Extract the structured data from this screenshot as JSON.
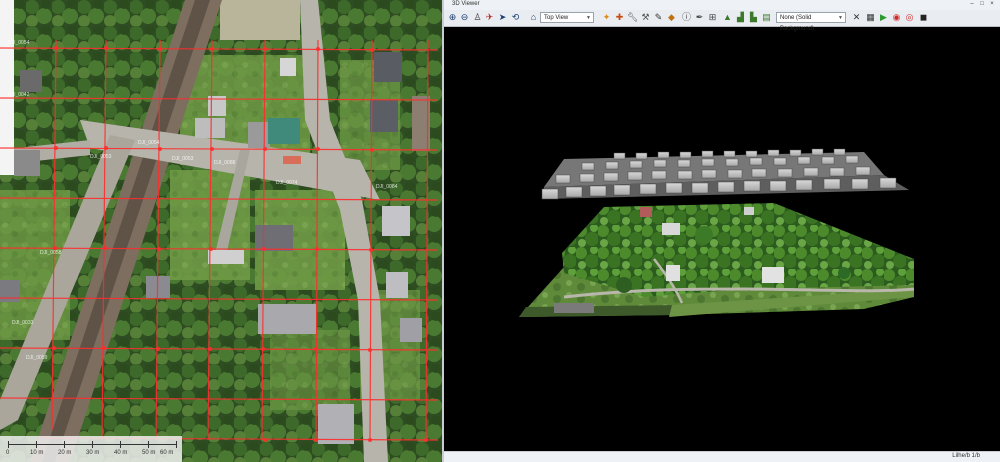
{
  "viewer": {
    "title": "3D Viewer",
    "view_select": "Top View",
    "background_select": "None (Solid Background)",
    "status_text": "Lilhe/b 1/b"
  },
  "map": {
    "scale_ticks": [
      "0",
      "10 m",
      "20 m",
      "30 m",
      "40 m",
      "50 m",
      "60 m"
    ],
    "grid_labels": [
      "DJI_0054",
      "DJI_0053",
      "DJI_0086",
      "DJI_0074",
      "DJI_0084",
      "DJI_0053",
      "DJI_0058",
      "DJI_0059",
      "DJI_0054",
      "DJI_0042",
      "DJI_0033"
    ]
  },
  "colors": {
    "flight_line": "#ff2d2d",
    "viewer_bg": "#000000",
    "toolbar_bg": "#e9ecf0"
  },
  "icons": [
    "zoom-in-icon",
    "zoom-out-icon",
    "walk-icon",
    "fly-icon",
    "select-icon",
    "rotate-icon",
    "home-icon",
    "crosshair-icon",
    "move-icon",
    "wrench-icon",
    "measure-icon",
    "pencil-icon",
    "ruler-icon",
    "info-icon",
    "eyedropper-icon",
    "hierarchy-icon",
    "terrain-icon",
    "chart-icon",
    "settings-icon",
    "close-tool-icon",
    "image-icon",
    "play-icon",
    "record-icon",
    "stop-icon",
    "camera-icon"
  ]
}
